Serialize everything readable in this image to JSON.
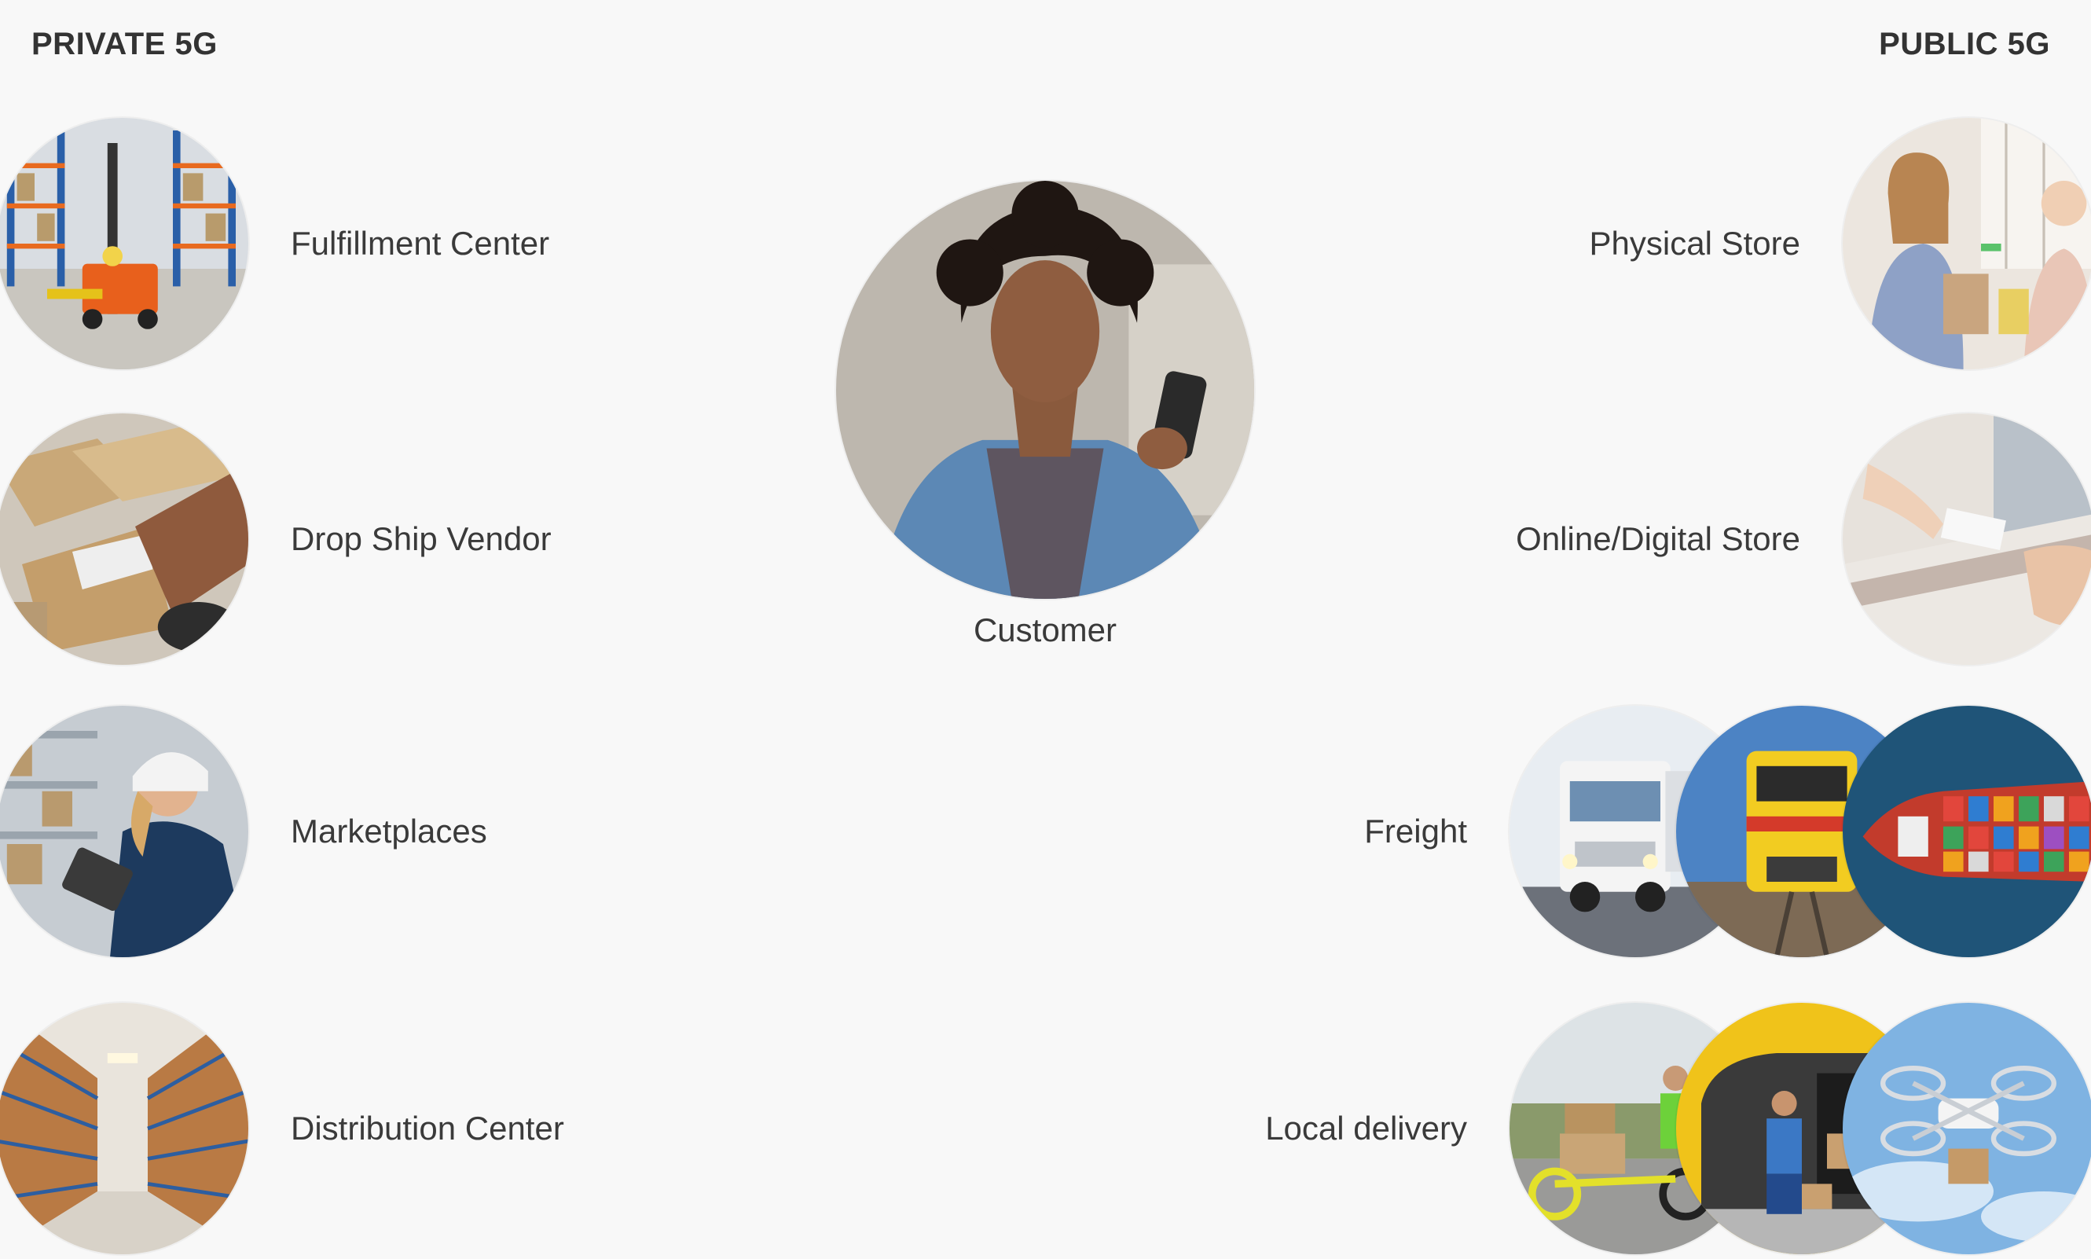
{
  "headings": {
    "private": "PRIVATE 5G",
    "public": "PUBLIC 5G"
  },
  "center": {
    "label": "Customer",
    "icon": "customer-phone-photo"
  },
  "private_nodes": [
    {
      "label": "Fulfillment Center",
      "icon": "forklift-warehouse-photo"
    },
    {
      "label": "Drop Ship Vendor",
      "icon": "packing-boxes-photo"
    },
    {
      "label": "Marketplaces",
      "icon": "worker-tablet-photo"
    },
    {
      "label": "Distribution Center",
      "icon": "warehouse-aisle-photo"
    }
  ],
  "public_nodes": [
    {
      "label": "Physical Store",
      "icon": "store-checkout-photo"
    },
    {
      "label": "Online/Digital Store",
      "icon": "card-payment-photo"
    },
    {
      "label": "Freight",
      "icons": [
        "truck-photo",
        "train-photo",
        "cargo-ship-photo"
      ]
    },
    {
      "label": "Local delivery",
      "icons": [
        "cargo-bike-photo",
        "delivery-van-photo",
        "drone-photo"
      ]
    }
  ],
  "colors": {
    "background": "#f8f8f8",
    "text": "#3f3f3f"
  }
}
